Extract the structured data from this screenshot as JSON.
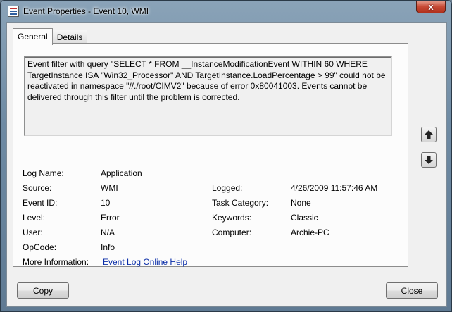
{
  "window": {
    "title": "Event Properties - Event 10, WMI",
    "close_label": "x"
  },
  "tabs": [
    {
      "label": "General",
      "active": true
    },
    {
      "label": "Details",
      "active": false
    }
  ],
  "description": "Event filter with query \"SELECT * FROM __InstanceModificationEvent WITHIN 60 WHERE TargetInstance ISA \"Win32_Processor\" AND TargetInstance.LoadPercentage > 99\" could not be reactivated in namespace \"//./root/CIMV2\" because of error 0x80041003. Events cannot be delivered through this filter until the problem is corrected.",
  "fields": {
    "log_name": {
      "label": "Log Name:",
      "value": "Application"
    },
    "source": {
      "label": "Source:",
      "value": "WMI"
    },
    "logged": {
      "label": "Logged:",
      "value": "4/26/2009 11:57:46 AM"
    },
    "event_id": {
      "label": "Event ID:",
      "value": "10"
    },
    "task_category": {
      "label": "Task Category:",
      "value": "None"
    },
    "level": {
      "label": "Level:",
      "value": "Error"
    },
    "keywords": {
      "label": "Keywords:",
      "value": "Classic"
    },
    "user": {
      "label": "User:",
      "value": "N/A"
    },
    "computer": {
      "label": "Computer:",
      "value": "Archie-PC"
    },
    "opcode": {
      "label": "OpCode:",
      "value": "Info"
    },
    "more_info": {
      "label": "More Information:",
      "value": "Event Log Online Help"
    }
  },
  "buttons": {
    "copy": "Copy",
    "close": "Close"
  },
  "icons": {
    "previous": "arrow-up-icon",
    "next": "arrow-down-icon"
  }
}
